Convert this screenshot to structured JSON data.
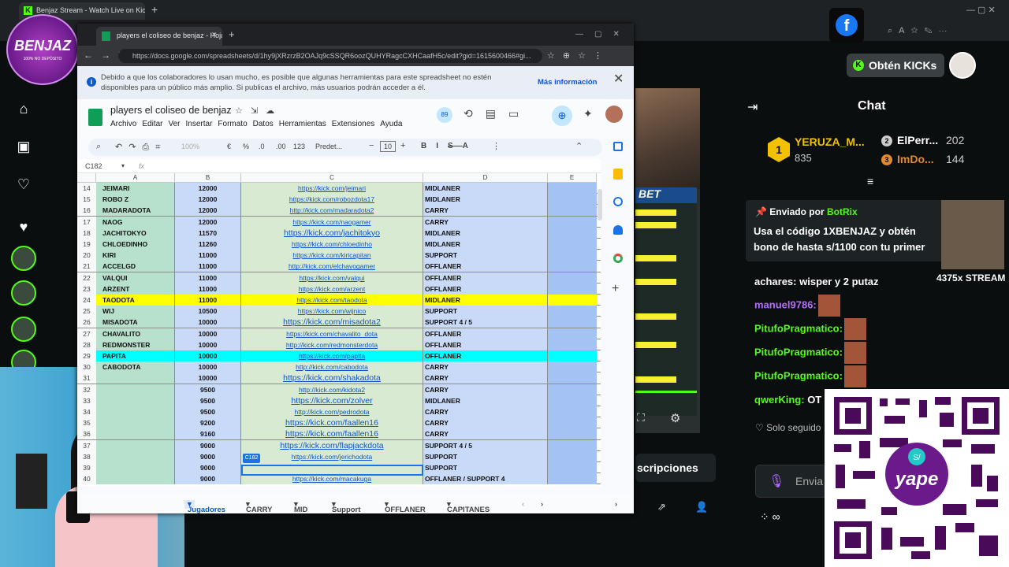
{
  "outer_browser": {
    "tab_title": "Benjaz Stream - Watch Live on Kick",
    "new_tab": "+"
  },
  "sheets_window": {
    "tab_title": "players el coliseo de benjaz - Hoja",
    "url": "https://docs.google.com/spreadsheets/d/1hy9jXRzrzB2OAJq9cSSQR6oozQUHYRagcCXHCaafH5c/edit?gid=1615600466#gi...",
    "banner_text": "Debido a que los colaboradores lo usan mucho, es posible que algunas herramientas para este spreadsheet no estén disponibles para un público más amplio. Si publicas el archivo, más usuarios podrán acceder a él.",
    "banner_link": "Más información",
    "doc_title": "players el coliseo de benjaz",
    "menu": [
      "Archivo",
      "Editar",
      "Ver",
      "Insertar",
      "Formato",
      "Datos",
      "Herramientas",
      "Extensiones",
      "Ayuda"
    ],
    "toolbar": {
      "zoom": "100%",
      "currency": "€",
      "percent": "%",
      "dec_less": ".0",
      "dec_more": ".00",
      "fmt": "123",
      "font": "Predet...",
      "size": "10"
    },
    "name_box": "C182",
    "fx": "fx",
    "user_count": "89",
    "columns": [
      "A",
      "B",
      "C",
      "D",
      "E"
    ],
    "cell_tooltip": "C182",
    "rows": [
      {
        "n": "14",
        "a": "JEIMARI",
        "b": "12000",
        "c": "https://kick.com/jeimari",
        "d": "MIDLANER",
        "style": ""
      },
      {
        "n": "15",
        "a": "ROBO Z",
        "b": "12000",
        "c": "https://kick.com/robozdota17",
        "d": "MIDLANER",
        "style": ""
      },
      {
        "n": "16",
        "a": "MADARADOTA",
        "b": "12000",
        "c": "http://kick.com/madaradota2",
        "d": "CARRY",
        "style": ""
      },
      {
        "n": "17",
        "a": "NAOG",
        "b": "12000",
        "c": "https://kick.com/naogamer",
        "d": "CARRY",
        "style": ""
      },
      {
        "n": "18",
        "a": "JACHITOKYO",
        "b": "11570",
        "c": "https://kick.com/jachitokyo",
        "d": "MIDLANER",
        "style": "big"
      },
      {
        "n": "19",
        "a": "CHLOEDINHO",
        "b": "11260",
        "c": "https://kick.com/chloedinho",
        "d": "MIDLANER",
        "style": ""
      },
      {
        "n": "20",
        "a": "KIRI",
        "b": "11000",
        "c": "https://kick.com/kiricapitan",
        "d": "SUPPORT",
        "style": ""
      },
      {
        "n": "21",
        "a": "ACCELGD",
        "b": "11000",
        "c": "http://kick.com/elchavogamer",
        "d": "OFFLANER",
        "style": ""
      },
      {
        "n": "22",
        "a": "VALQUI",
        "b": "11000",
        "c": "https://kick.com/valqui",
        "d": "OFFLANER",
        "style": ""
      },
      {
        "n": "23",
        "a": "ARZENT",
        "b": "11000",
        "c": "https://kick.com/arzent",
        "d": "OFFLANER",
        "style": ""
      },
      {
        "n": "24",
        "a": "TAODOTA",
        "b": "11000",
        "c": "https://kick.com/taodota",
        "d": "MIDLANER",
        "style": "yel"
      },
      {
        "n": "25",
        "a": "WIJ",
        "b": "10500",
        "c": "https://kick.com/wijnico",
        "d": "SUPPORT",
        "style": ""
      },
      {
        "n": "26",
        "a": "MISADOTA",
        "b": "10000",
        "c": "https://kick.com/misadota2",
        "d": "SUPPORT 4 / 5",
        "style": "big"
      },
      {
        "n": "27",
        "a": "CHAVALITO",
        "b": "10000",
        "c": "https://kick.com/chavalito_dota",
        "d": "OFFLANER",
        "style": ""
      },
      {
        "n": "28",
        "a": "REDMONSTER",
        "b": "10000",
        "c": "http://kick.com/redmonsterdota",
        "d": "OFFLANER",
        "style": ""
      },
      {
        "n": "29",
        "a": "PAPITA",
        "b": "10000",
        "c": "https://kick.com/papita",
        "d": "OFFLANER",
        "style": "cya"
      },
      {
        "n": "30",
        "a": "CABODOTA",
        "b": "10000",
        "c": "http://kick.com/cabodota",
        "d": "CARRY",
        "style": ""
      },
      {
        "n": "31",
        "a": "",
        "b": "10000",
        "c": "https://kick.com/shakadota",
        "d": "CARRY",
        "style": "big"
      },
      {
        "n": "32",
        "a": "",
        "b": "9500",
        "c": "http://kick.com/kidota2",
        "d": "CARRY",
        "style": ""
      },
      {
        "n": "33",
        "a": "",
        "b": "9500",
        "c": "https://kick.com/zolver",
        "d": "MIDLANER",
        "style": "big"
      },
      {
        "n": "34",
        "a": "",
        "b": "9500",
        "c": "http://kick.com/pedrodota",
        "d": "CARRY",
        "style": ""
      },
      {
        "n": "35",
        "a": "",
        "b": "9200",
        "c": "https://kick.com/faallen16",
        "d": "CARRY",
        "style": "big"
      },
      {
        "n": "36",
        "a": "",
        "b": "9160",
        "c": "https://kick.com/faallen16",
        "d": "CARRY",
        "style": "big"
      },
      {
        "n": "37",
        "a": "",
        "b": "9000",
        "c": "https://kick.com/flapjackdota",
        "d": "SUPPORT 4 / 5",
        "style": "big"
      },
      {
        "n": "38",
        "a": "",
        "b": "9000",
        "c": "https://kick.com/jerichodota",
        "d": "SUPPORT",
        "style": ""
      },
      {
        "n": "39",
        "a": "",
        "b": "9000",
        "c": "",
        "d": "SUPPORT",
        "style": ""
      },
      {
        "n": "40",
        "a": "",
        "b": "9000",
        "c": "https://kick.com/macakuga",
        "d": "OFFLANER / SUPPORT 4",
        "style": ""
      }
    ],
    "sheet_tabs": [
      "Jugadores",
      "CARRY",
      "MID",
      "Support",
      "OFFLANER",
      "CAPITANES"
    ]
  },
  "stream": {
    "bet_text": "BET"
  },
  "chat": {
    "get_kicks": "Obtén KICKs",
    "title": "Chat",
    "leaders": [
      {
        "rank": "1",
        "name": "YERUZA_M...",
        "value": "835"
      },
      {
        "rank": "2",
        "name": "ElPerr...",
        "value": "202"
      },
      {
        "rank": "3",
        "name": "ImDo...",
        "value": "144"
      }
    ],
    "pinned_by": "Enviado por",
    "pinned_user": "BotRix",
    "pinned_text": "Usa el código 1XBENJAZ y obtén bono de hasta s/1100 con tu primer",
    "sticker_caption": "4375x STREAM",
    "messages": [
      {
        "user": "achares:",
        "text": "wisper y 2 putaz",
        "color": "#ffffff"
      },
      {
        "user": "manuel9786:",
        "text": "",
        "color": "#b46cff"
      },
      {
        "user": "PitufoPragmatico:",
        "text": "",
        "color": "#53fc18"
      },
      {
        "user": "PitufoPragmatico:",
        "text": "",
        "color": "#53fc18"
      },
      {
        "user": "PitufoPragmatico:",
        "text": "",
        "color": "#53fc18"
      },
      {
        "user": "qwerKing:",
        "text": "OT",
        "color": "#53fc18"
      }
    ],
    "followers_only": "Solo seguido",
    "send": "Envia",
    "subs": "scripciones"
  },
  "overlay": {
    "logo_text": "BENJAZ",
    "logo_sub": "100% NO DEPÓSITO",
    "qr_label": "yape",
    "qr_currency": "S/"
  }
}
